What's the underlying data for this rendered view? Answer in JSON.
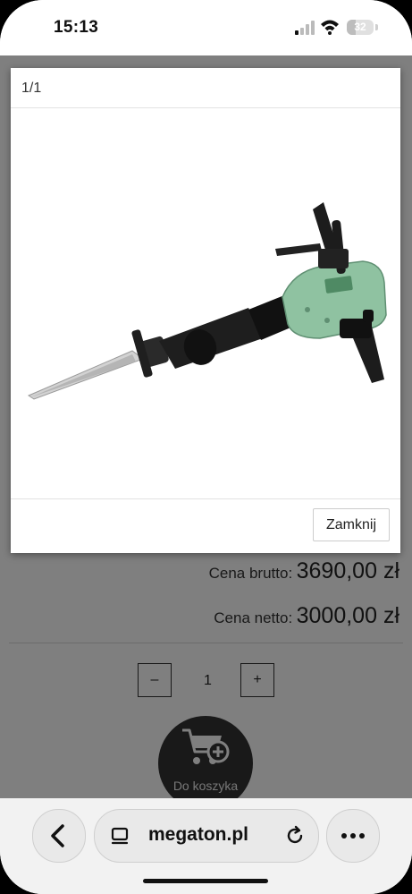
{
  "status": {
    "time": "15:13",
    "battery": "32",
    "battery_level": 0.32
  },
  "page": {
    "gross_label": "Cena brutto:",
    "gross_value": "3690,00 zł",
    "net_label": "Cena netto:",
    "net_value": "3000,00 zł",
    "qty_minus": "–",
    "qty_value": "1",
    "qty_plus": "+",
    "cart_label": "Do koszyka"
  },
  "modal": {
    "counter": "1/1",
    "close_label": "Zamknij"
  },
  "browser": {
    "url": "megaton.pl"
  },
  "icons": [
    "signal-icon",
    "wifi-icon",
    "back-icon",
    "tabs-icon",
    "reload-icon",
    "more-icon",
    "cart-add-icon"
  ],
  "colors": {
    "tool_body": "#8fc2a1",
    "overlay": "rgba(0,0,0,0.5)"
  }
}
